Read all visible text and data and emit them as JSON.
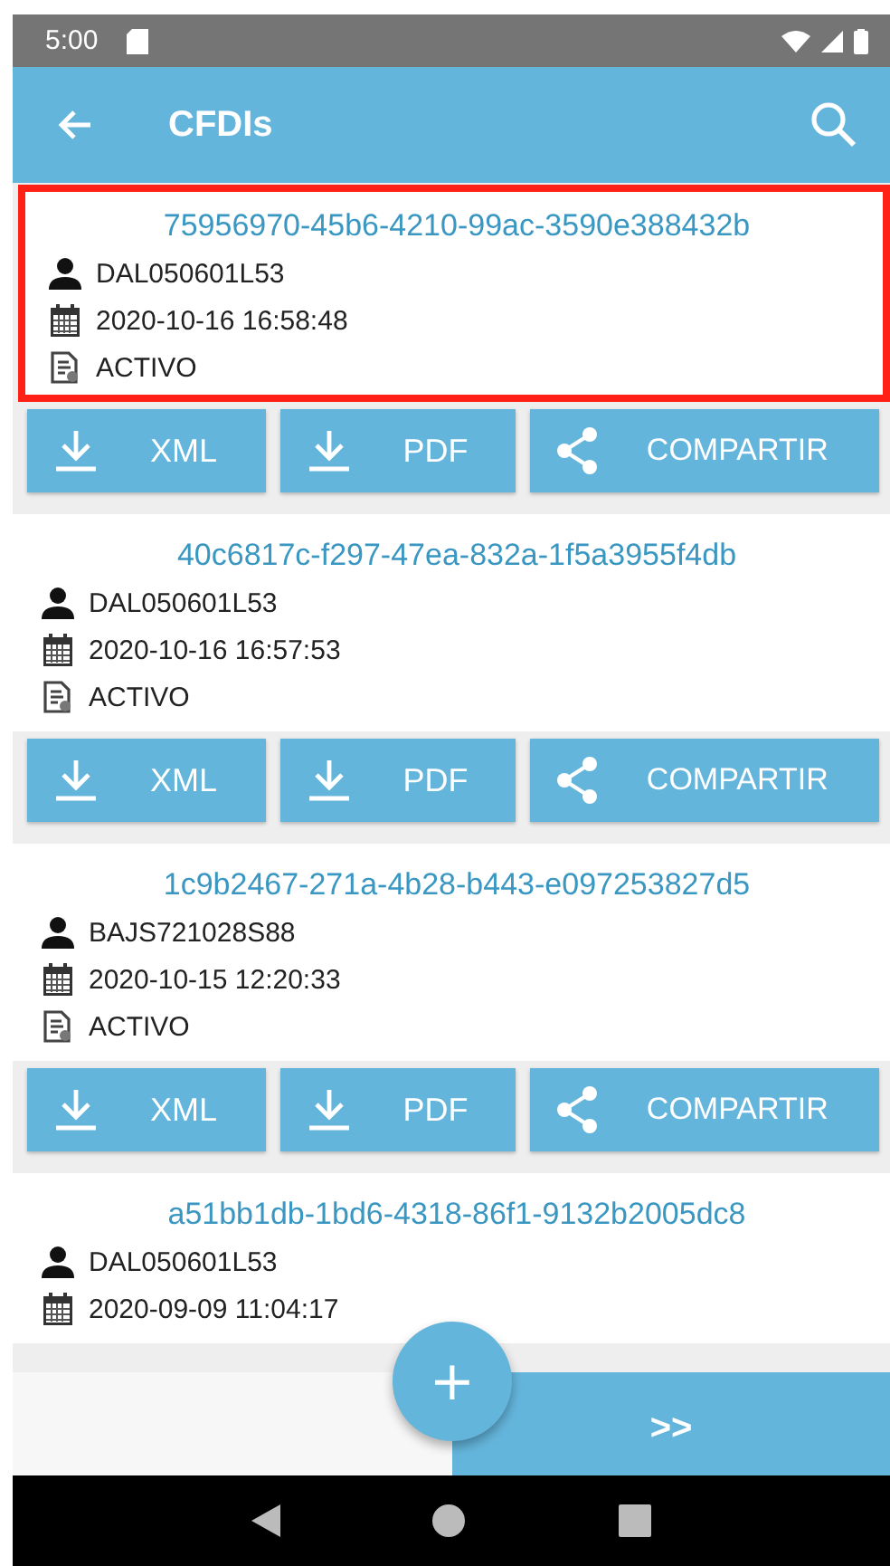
{
  "status_bar": {
    "time": "5:00"
  },
  "app_bar": {
    "title": "CFDIs"
  },
  "cfdis": [
    {
      "uuid": "75956970-45b6-4210-99ac-3590e388432b",
      "rfc": "DAL050601L53",
      "date": "2020-10-16 16:58:48",
      "status": "ACTIVO",
      "selected": true,
      "buttons": [
        "XML",
        "PDF",
        "COMPARTIR"
      ]
    },
    {
      "uuid": "40c6817c-f297-47ea-832a-1f5a3955f4db",
      "rfc": "DAL050601L53",
      "date": "2020-10-16 16:57:53",
      "status": "ACTIVO",
      "selected": false,
      "buttons": [
        "XML",
        "PDF",
        "COMPARTIR"
      ]
    },
    {
      "uuid": "1c9b2467-271a-4b28-b443-e097253827d5",
      "rfc": "BAJS721028S88",
      "date": "2020-10-15 12:20:33",
      "status": "ACTIVO",
      "selected": false,
      "buttons": [
        "XML",
        "PDF",
        "COMPARTIR"
      ]
    },
    {
      "uuid": "a51bb1db-1bd6-4318-86f1-9132b2005dc8",
      "rfc": "DAL050601L53",
      "date": "2020-09-09 11:04:17",
      "selected": false
    }
  ],
  "fab": {
    "label": "+"
  },
  "next_button": {
    "label": ">>"
  }
}
